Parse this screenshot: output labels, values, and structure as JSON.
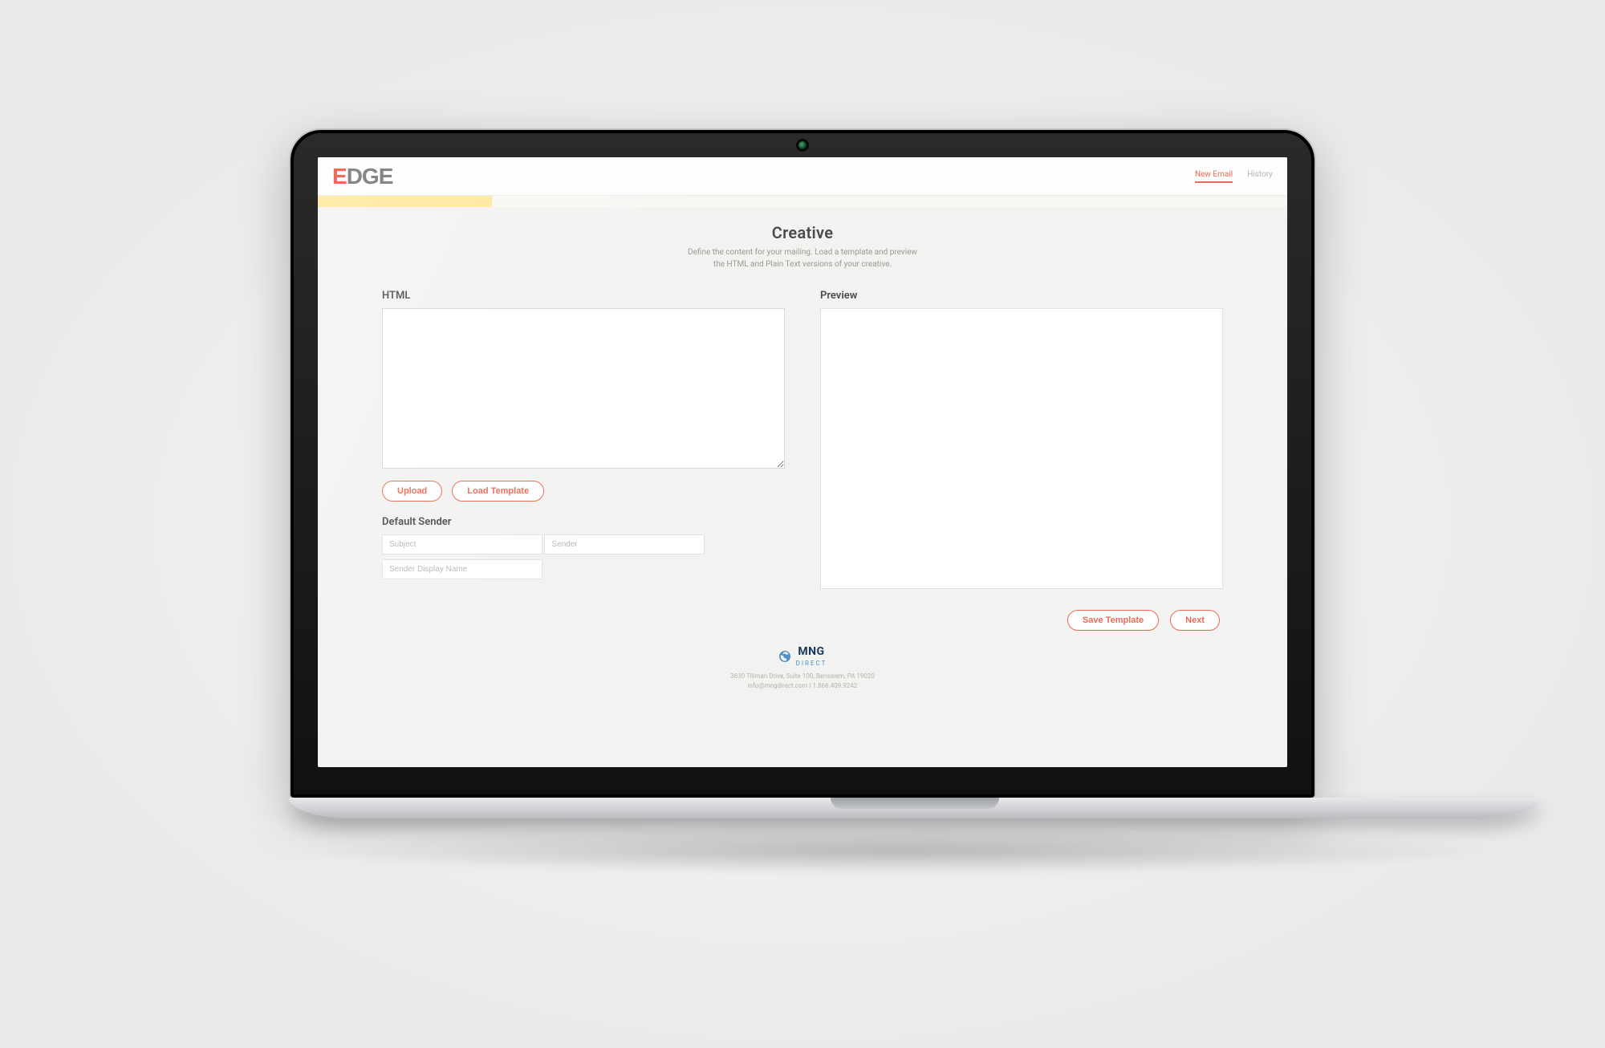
{
  "brand": {
    "text": "EDGE"
  },
  "nav": {
    "new_email": "New Email",
    "history": "History"
  },
  "page": {
    "title": "Creative",
    "subtitle_line1": "Define the content for your mailing. Load a template and preview",
    "subtitle_line2": "the HTML and Plain Text versions of your creative."
  },
  "sections": {
    "html_label": "HTML",
    "preview_label": "Preview",
    "default_sender_label": "Default Sender"
  },
  "buttons": {
    "upload": "Upload",
    "load_template": "Load Template",
    "save_template": "Save Template",
    "next": "Next"
  },
  "inputs": {
    "html_value": "",
    "subject_placeholder": "Subject",
    "sender_placeholder": "Sender",
    "sender_display_placeholder": "Sender Display Name"
  },
  "footer": {
    "company": "MNG",
    "company_sub": "DIRECT",
    "address": "3630 Tillman Drive, Suite 100, Bensalem, PA 19020",
    "contact": "info@mngdirect.com | 1.866.409.9242"
  }
}
